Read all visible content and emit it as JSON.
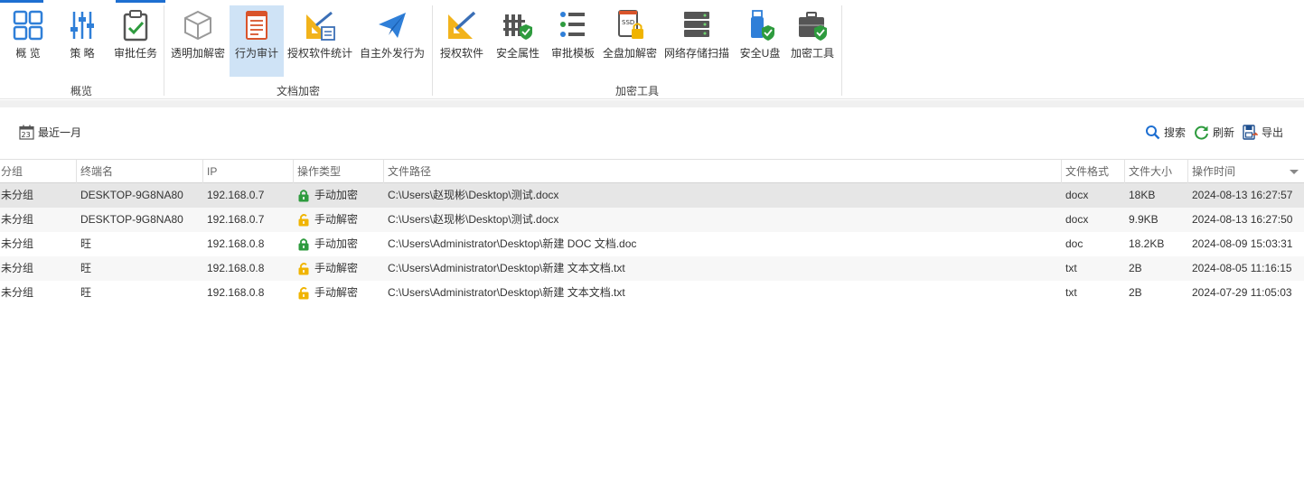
{
  "ribbon": {
    "groups": [
      {
        "label": "概览"
      },
      {
        "label": "文档加密"
      },
      {
        "label": "加密工具"
      }
    ],
    "buttons": [
      {
        "label": "概 览",
        "icon": "overview-grid-icon"
      },
      {
        "label": "策 略",
        "icon": "policy-sliders-icon"
      },
      {
        "label": "审批任务",
        "icon": "approval-clipboard-icon"
      },
      {
        "label": "透明加解密",
        "icon": "transparent-cube-icon"
      },
      {
        "label": "行为审计",
        "icon": "audit-document-icon"
      },
      {
        "label": "授权软件统计",
        "icon": "licensed-software-stats-icon"
      },
      {
        "label": "自主外发行为",
        "icon": "paper-plane-icon"
      },
      {
        "label": "授权软件",
        "icon": "licensed-software-icon"
      },
      {
        "label": "安全属性",
        "icon": "security-attribute-icon"
      },
      {
        "label": "审批模板",
        "icon": "approval-template-icon"
      },
      {
        "label": "全盘加解密",
        "icon": "ssd-lock-icon"
      },
      {
        "label": "网络存储扫描",
        "icon": "network-storage-icon"
      },
      {
        "label": "安全U盘",
        "icon": "secure-usb-icon"
      },
      {
        "label": "加密工具",
        "icon": "toolbox-shield-icon"
      }
    ],
    "active_index": 4
  },
  "toolbar": {
    "date_filter": "最近一月",
    "calendar_day": "23",
    "search": "搜索",
    "refresh": "刷新",
    "export": "导出"
  },
  "table": {
    "columns": [
      "分组",
      "终端名",
      "IP",
      "操作类型",
      "文件路径",
      "文件格式",
      "文件大小",
      "操作时间"
    ],
    "sort_column": "操作时间",
    "rows": [
      {
        "group": "未分组",
        "terminal": "DESKTOP-9G8NA80",
        "ip": "192.168.0.7",
        "op_type": "手动加密",
        "op_lock": "locked",
        "path": "C:\\Users\\赵现彬\\Desktop\\测试.docx",
        "format": "docx",
        "size": "18KB",
        "time": "2024-08-13 16:27:57"
      },
      {
        "group": "未分组",
        "terminal": "DESKTOP-9G8NA80",
        "ip": "192.168.0.7",
        "op_type": "手动解密",
        "op_lock": "unlocked",
        "path": "C:\\Users\\赵现彬\\Desktop\\测试.docx",
        "format": "docx",
        "size": "9.9KB",
        "time": "2024-08-13 16:27:50"
      },
      {
        "group": "未分组",
        "terminal": "旺",
        "ip": "192.168.0.8",
        "op_type": "手动加密",
        "op_lock": "locked",
        "path": "C:\\Users\\Administrator\\Desktop\\新建 DOC 文档.doc",
        "format": "doc",
        "size": "18.2KB",
        "time": "2024-08-09 15:03:31"
      },
      {
        "group": "未分组",
        "terminal": "旺",
        "ip": "192.168.0.8",
        "op_type": "手动解密",
        "op_lock": "unlocked",
        "path": "C:\\Users\\Administrator\\Desktop\\新建 文本文档.txt",
        "format": "txt",
        "size": "2B",
        "time": "2024-08-05 11:16:15"
      },
      {
        "group": "未分组",
        "terminal": "旺",
        "ip": "192.168.0.8",
        "op_type": "手动解密",
        "op_lock": "unlocked",
        "path": "C:\\Users\\Administrator\\Desktop\\新建 文本文档.txt",
        "format": "txt",
        "size": "2B",
        "time": "2024-07-29 11:05:03"
      }
    ]
  },
  "colors": {
    "accent": "#1e6fd1",
    "active_button_bg": "#cfe3f6",
    "selected_row_bg": "#e6e6e6",
    "lock_green": "#2e9b3e",
    "lock_yellow": "#f0b400"
  }
}
